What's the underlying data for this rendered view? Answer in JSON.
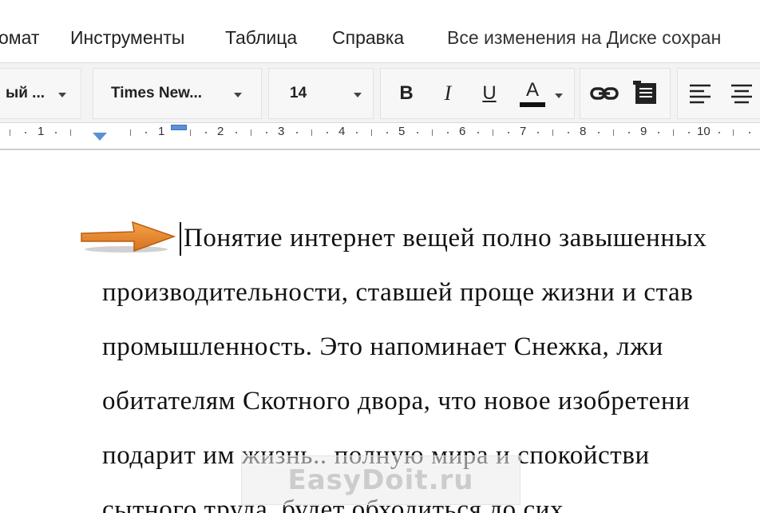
{
  "menu": {
    "items": [
      "омат",
      "Инструменты",
      "Таблица",
      "Справка"
    ],
    "status": "Все изменения на Диске сохран"
  },
  "toolbar": {
    "style_select": "ый ...",
    "font_select": "Times New...",
    "size_select": "14",
    "bold_label": "B",
    "italic_label": "I",
    "underline_label": "U",
    "text_color_label": "A",
    "text_color": "#111111"
  },
  "ruler": {
    "numbers": [
      "1",
      "1",
      "2",
      "3",
      "4",
      "5",
      "6",
      "7",
      "8",
      "9",
      "10"
    ]
  },
  "document": {
    "lines": [
      "Понятие интернет вещей полно завышенных",
      "производительности, ставшей проще жизни и став",
      "промышленность. Это напоминает Снежка, лжи",
      "обитателям Скотного двора, что новое изобретени",
      "подарит им жизнь.. полную мира и спокойстви",
      "сытного труда, будет обходиться до сих"
    ]
  },
  "watermark": {
    "text": "EasyDoit.ru"
  },
  "colors": {
    "accent": "#5b8fd6",
    "arrow": "#e88a2c"
  }
}
